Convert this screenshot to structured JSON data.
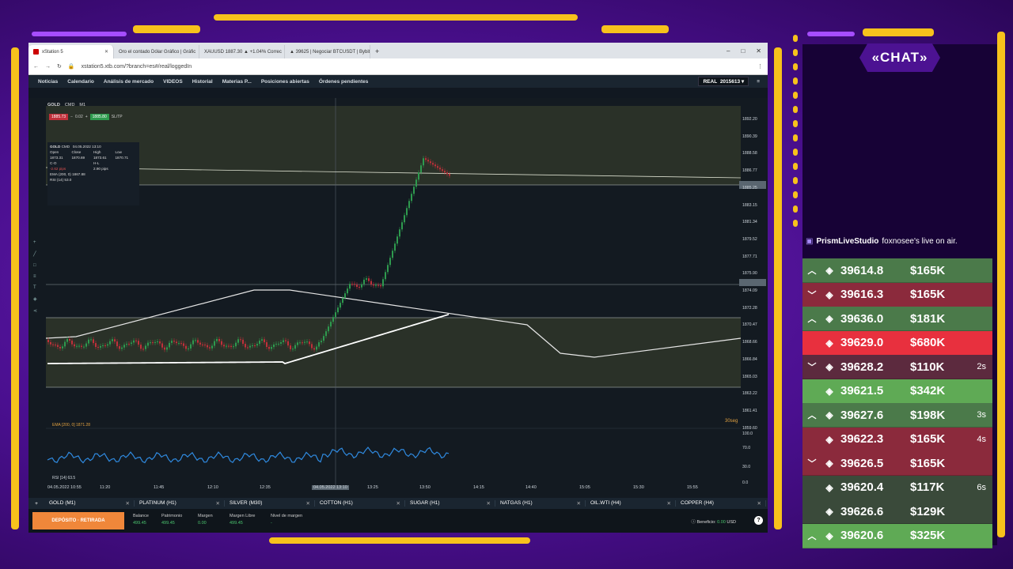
{
  "browser": {
    "tabs": [
      {
        "label": "xStation 5",
        "active": true
      },
      {
        "label": "Oro el contado Dólar Gráfico | Gráfic",
        "active": false
      },
      {
        "label": "XAUUSD 1887.30 ▲ +1.04% Correc",
        "active": false
      },
      {
        "label": "▲ 39625 | Negociar BTCUSDT | Bybit",
        "active": false
      }
    ],
    "url": "xstation5.xtb.com/?branch=es#/real/loggedIn",
    "window_controls": [
      "–",
      "□",
      "✕"
    ]
  },
  "menu": {
    "items": [
      "Noticias",
      "Calendario",
      "Análisis de mercado",
      "VIDEOS",
      "Historial",
      "Materias P...",
      "Posiciones abiertas",
      "Órdenes pendientes"
    ],
    "account_type": "REAL",
    "account_id": "2015613"
  },
  "chart": {
    "symbol": "GOLD",
    "symbol_tag": "CMD",
    "timeframe": "M1",
    "sell_price": "1885.73",
    "spread": "0.02",
    "buy_price": "1885.80",
    "sltp": "SL/TP",
    "info_box": {
      "symbol": "GOLD",
      "tag": "CMD",
      "datetime": "04.05.2022 13:10",
      "headers": [
        "Open",
        "Close",
        "High",
        "Low"
      ],
      "values": [
        "1873.31",
        "1870.69",
        "1873.61",
        "1870.71"
      ],
      "co_label": "C-O",
      "co_value": "-2.62 pips",
      "hl_label": "H-L",
      "hl_value": "2.90 pips",
      "ema_label": "EMA (200, 0)",
      "ema_value": "1867.88",
      "rsi_label": "RSI (14)",
      "rsi_value": "53.0"
    },
    "y_axis": [
      "1892.20",
      "1890.39",
      "1888.58",
      "1886.77",
      "1885.25",
      "1883.15",
      "1881.34",
      "1879.52",
      "1877.71",
      "1875.90",
      "1874.09",
      "1872.28",
      "1870.47",
      "1868.66",
      "1866.84",
      "1865.03",
      "1863.22",
      "1861.41",
      "1859.60"
    ],
    "x_axis": [
      "04.05.2022 10:55",
      "11:20",
      "11:45",
      "12:10",
      "12:35",
      "04.05.2022 13:10",
      "13:25",
      "13:50",
      "14:15",
      "14:40",
      "15:05",
      "15:30",
      "15:55"
    ],
    "ema_legend": "EMA [200, 0] 1871.28",
    "rsi_legend": "RSI [14] 63.5",
    "rsi_axis": [
      "100.0",
      "70.0",
      "30.0",
      "0.0"
    ],
    "interval_label": "30seg"
  },
  "bottom_tabs": [
    "GOLD (M1)",
    "PLATINUM (H1)",
    "SILVER (M30)",
    "COTTON (H1)",
    "SUGAR (H1)",
    "NATGAS (H1)",
    "OIL.WTI (H4)",
    "COPPER (H4)"
  ],
  "status": {
    "deposit_label": "DEPÓSITO · RETIRADA",
    "balance_label": "Balance",
    "balance_value": "499.45",
    "equity_label": "Patrimonio",
    "equity_value": "499.45",
    "margin_label": "Margen",
    "margin_value": "0.00",
    "free_label": "Margen Libre",
    "free_value": "499.45",
    "level_label": "Nivel de margen",
    "level_value": "-",
    "profit_label": "Beneficio:",
    "profit_value": "0.00",
    "profit_currency": "USD"
  },
  "chat": {
    "title": "«CHAT»",
    "live_user": "PrismLiveStudio",
    "live_text": "foxnosee's live on air.",
    "trades": [
      {
        "dir": "up",
        "price": "39614.8",
        "amount": "$165K",
        "time": "",
        "color": "#4b7a4a"
      },
      {
        "dir": "down",
        "price": "39616.3",
        "amount": "$165K",
        "time": "",
        "color": "#8b2a3c"
      },
      {
        "dir": "up",
        "price": "39636.0",
        "amount": "$181K",
        "time": "",
        "color": "#4b7a4a"
      },
      {
        "dir": "",
        "price": "39629.0",
        "amount": "$680K",
        "time": "",
        "color": "#e8303e"
      },
      {
        "dir": "down",
        "price": "39628.2",
        "amount": "$110K",
        "time": "2s",
        "color": "#5c2a3e"
      },
      {
        "dir": "",
        "price": "39621.5",
        "amount": "$342K",
        "time": "",
        "color": "#5faa55"
      },
      {
        "dir": "up",
        "price": "39627.6",
        "amount": "$198K",
        "time": "3s",
        "color": "#4b7a4a"
      },
      {
        "dir": "",
        "price": "39622.3",
        "amount": "$165K",
        "time": "4s",
        "color": "#8b2a3c"
      },
      {
        "dir": "down",
        "price": "39626.5",
        "amount": "$165K",
        "time": "",
        "color": "#8b2a3c"
      },
      {
        "dir": "",
        "price": "39620.4",
        "amount": "$117K",
        "time": "6s",
        "color": "#3a4a3a"
      },
      {
        "dir": "",
        "price": "39626.6",
        "amount": "$129K",
        "time": "",
        "color": "#3a4a3a"
      },
      {
        "dir": "up",
        "price": "39620.6",
        "amount": "$325K",
        "time": "",
        "color": "#5faa55"
      }
    ]
  }
}
